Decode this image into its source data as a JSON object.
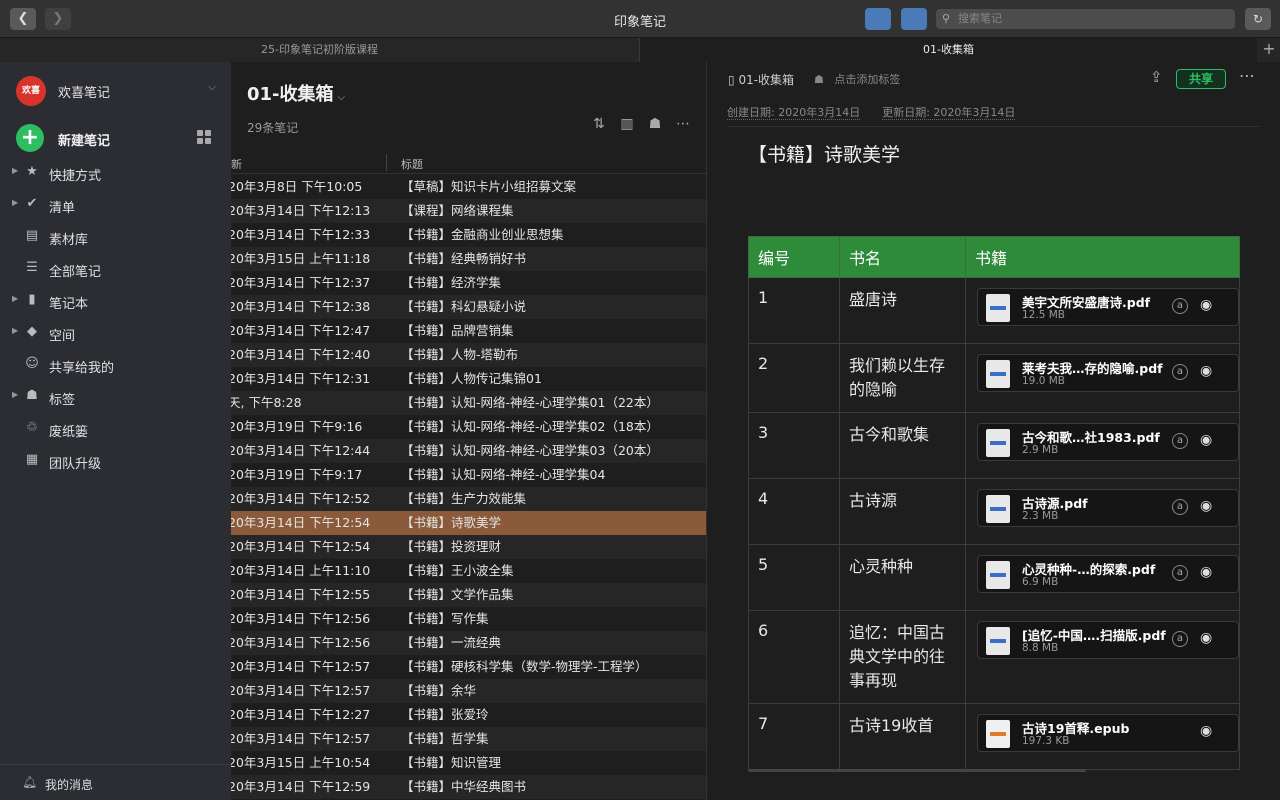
{
  "window": {
    "title": "印象笔记"
  },
  "toolbar": {
    "back_icon": "chevron-left-icon",
    "forward_icon": "chevron-right-icon",
    "search_placeholder": "搜索笔记"
  },
  "tabs": [
    {
      "label": "25-印象笔记初阶版课程"
    },
    {
      "label": "01-收集箱"
    }
  ],
  "sidebar": {
    "account": {
      "avatar_text": "欢喜",
      "name": "欢喜笔记"
    },
    "new_note": "新建笔记",
    "items": [
      {
        "label": "快捷方式",
        "icon": "star-icon",
        "expandable": true
      },
      {
        "label": "清单",
        "icon": "check-circle-icon",
        "expandable": true
      },
      {
        "label": "素材库",
        "icon": "library-icon",
        "expandable": false
      },
      {
        "label": "全部笔记",
        "icon": "notes-icon",
        "expandable": false
      },
      {
        "label": "笔记本",
        "icon": "notebook-icon",
        "expandable": true
      },
      {
        "label": "空间",
        "icon": "cube-icon",
        "expandable": true
      },
      {
        "label": "共享给我的",
        "icon": "people-icon",
        "expandable": false
      },
      {
        "label": "标签",
        "icon": "tag-icon",
        "expandable": true
      },
      {
        "label": "废纸篓",
        "icon": "trash-icon",
        "expandable": false
      },
      {
        "label": "团队升级",
        "icon": "building-icon",
        "expandable": false
      }
    ],
    "messages": "我的消息"
  },
  "notelist": {
    "title": "01-收集箱",
    "count": "29条笔记",
    "columns": {
      "updated": "新",
      "title": "标题"
    },
    "rows": [
      {
        "date": "20年3月8日 下午10:05",
        "title": "【草稿】知识卡片小组招募文案"
      },
      {
        "date": "20年3月14日 下午12:13",
        "title": "【课程】网络课程集"
      },
      {
        "date": "20年3月14日 下午12:33",
        "title": "【书籍】金融商业创业思想集"
      },
      {
        "date": "20年3月15日 上午11:18",
        "title": "【书籍】经典畅销好书"
      },
      {
        "date": "20年3月14日 下午12:37",
        "title": "【书籍】经济学集"
      },
      {
        "date": "20年3月14日 下午12:38",
        "title": "【书籍】科幻悬疑小说"
      },
      {
        "date": "20年3月14日 下午12:47",
        "title": "【书籍】品牌营销集"
      },
      {
        "date": "20年3月14日 下午12:40",
        "title": "【书籍】人物-塔勒布"
      },
      {
        "date": "20年3月14日 下午12:31",
        "title": "【书籍】人物传记集锦01"
      },
      {
        "date": "天, 下午8:28",
        "title": "【书籍】认知-网络-神经-心理学集01（22本）"
      },
      {
        "date": "20年3月19日 下午9:16",
        "title": "【书籍】认知-网络-神经-心理学集02（18本）"
      },
      {
        "date": "20年3月14日 下午12:44",
        "title": "【书籍】认知-网络-神经-心理学集03（20本）"
      },
      {
        "date": "20年3月19日 下午9:17",
        "title": "【书籍】认知-网络-神经-心理学集04"
      },
      {
        "date": "20年3月14日 下午12:52",
        "title": "【书籍】生产力效能集"
      },
      {
        "date": "20年3月14日 下午12:54",
        "title": "【书籍】诗歌美学",
        "selected": true
      },
      {
        "date": "20年3月14日 下午12:54",
        "title": "【书籍】投资理财"
      },
      {
        "date": "20年3月14日 上午11:10",
        "title": "【书籍】王小波全集"
      },
      {
        "date": "20年3月14日 下午12:55",
        "title": "【书籍】文学作品集"
      },
      {
        "date": "20年3月14日 下午12:56",
        "title": "【书籍】写作集"
      },
      {
        "date": "20年3月14日 下午12:56",
        "title": "【书籍】一流经典"
      },
      {
        "date": "20年3月14日 下午12:57",
        "title": "【书籍】硬核科学集（数学-物理学-工程学）"
      },
      {
        "date": "20年3月14日 下午12:57",
        "title": "【书籍】余华"
      },
      {
        "date": "20年3月14日 下午12:27",
        "title": "【书籍】张爱玲"
      },
      {
        "date": "20年3月14日 下午12:57",
        "title": "【书籍】哲学集"
      },
      {
        "date": "20年3月15日 上午10:54",
        "title": "【书籍】知识管理"
      },
      {
        "date": "20年3月14日 下午12:59",
        "title": "【书籍】中华经典图书"
      }
    ]
  },
  "editor": {
    "notebook": "01-收集箱",
    "tag_placeholder": "点击添加标签",
    "share_label": "共享",
    "created": "创建日期: 2020年3月14日",
    "updated": "更新日期: 2020年3月14日",
    "note_title": "【书籍】诗歌美学",
    "table": {
      "headers": [
        "编号",
        "书名",
        "书籍"
      ],
      "header_color": "#2e8b39",
      "rows": [
        {
          "no": "1",
          "name": "盛唐诗",
          "file": "美宇文所安盛唐诗.pdf",
          "size": "12.5 MB",
          "type": "pdf",
          "ai": true
        },
        {
          "no": "2",
          "name": "我们赖以生存的隐喻",
          "file": "莱考夫我…存的隐喻.pdf",
          "size": "19.0 MB",
          "type": "pdf",
          "ai": true
        },
        {
          "no": "3",
          "name": "古今和歌集",
          "file": "古今和歌…社1983.pdf",
          "size": "2.9 MB",
          "type": "pdf",
          "ai": true
        },
        {
          "no": "4",
          "name": "古诗源",
          "file": "古诗源.pdf",
          "size": "2.3 MB",
          "type": "pdf",
          "ai": true
        },
        {
          "no": "5",
          "name": "心灵种种",
          "file": "心灵种种-…的探索.pdf",
          "size": "6.9 MB",
          "type": "pdf",
          "ai": true
        },
        {
          "no": "6",
          "name": "追忆：中国古典文学中的往事再现",
          "file": "[追忆-中国….扫描版.pdf",
          "size": "8.8 MB",
          "type": "pdf",
          "ai": true
        },
        {
          "no": "7",
          "name": "古诗19收首",
          "file": "古诗19首释.epub",
          "size": "197.3 KB",
          "type": "epub",
          "ai": false
        }
      ]
    }
  }
}
